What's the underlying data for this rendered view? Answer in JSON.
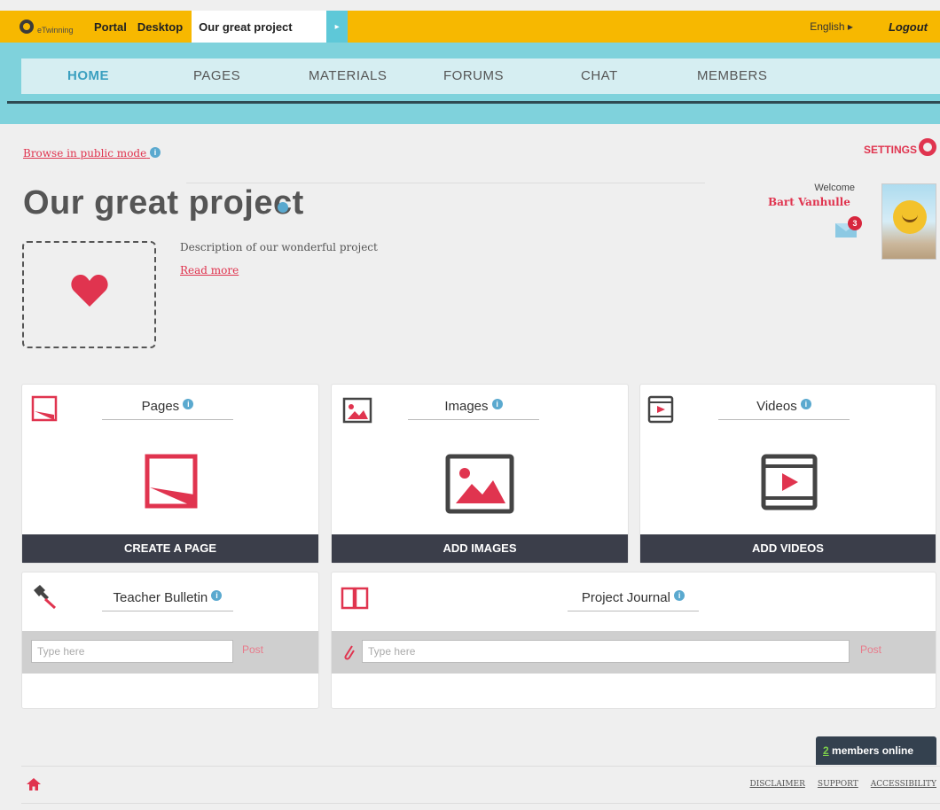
{
  "topbar": {
    "logo_text": "eTwinning",
    "links": [
      "Portal",
      "Desktop"
    ],
    "project_tab": "Our great project",
    "language": "English ▸",
    "logout": "Logout"
  },
  "nav": {
    "items": [
      "HOME",
      "PAGES",
      "MATERIALS",
      "FORUMS",
      "CHAT",
      "MEMBERS"
    ],
    "active": "HOME"
  },
  "browse_link": "Browse in public mode",
  "settings_label": "SETTINGS",
  "project": {
    "title": "Our great project",
    "description": "Description of our wonderful project",
    "read_more": "Read more"
  },
  "user": {
    "welcome": "Welcome",
    "name": "Bart Vanhulle",
    "unread_messages": "3"
  },
  "cards": {
    "pages": {
      "title": "Pages",
      "button": "CREATE A PAGE"
    },
    "images": {
      "title": "Images",
      "button": "ADD IMAGES"
    },
    "videos": {
      "title": "Videos",
      "button": "ADD VIDEOS"
    },
    "bulletin": {
      "title": "Teacher Bulletin",
      "placeholder": "Type here",
      "post": "Post"
    },
    "journal": {
      "title": "Project Journal",
      "placeholder": "Type here",
      "post": "Post"
    }
  },
  "footer": {
    "online_count": "2",
    "online_label": " members online",
    "links": [
      "DISCLAIMER",
      "SUPPORT",
      "ACCESSIBILITY"
    ]
  },
  "colors": {
    "accent": "#e0344f",
    "topbar": "#f7b800",
    "nav": "#7fd2dc",
    "button": "#3b3e4a"
  }
}
